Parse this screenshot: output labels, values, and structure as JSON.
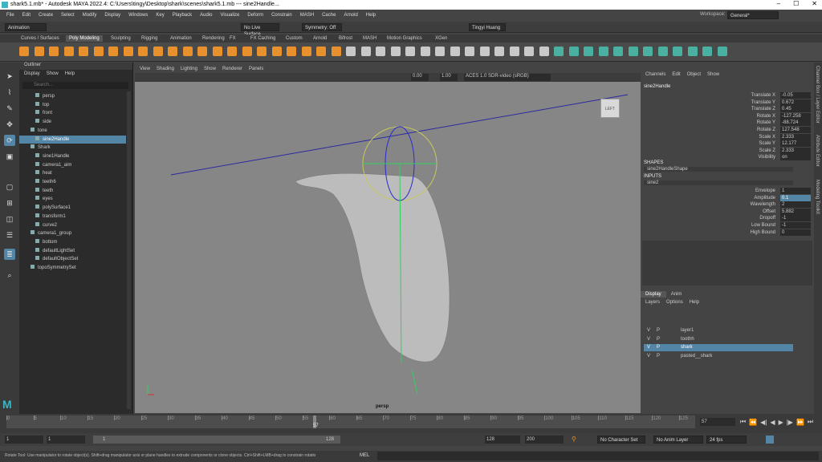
{
  "title": "shark5.1.mb* - Autodesk MAYA 2022.4: C:\\Users\\tingy\\Desktop\\shark\\scenes\\shark5.1.mb --- sine2Handle...",
  "menu": [
    "File",
    "Edit",
    "Create",
    "Select",
    "Modify",
    "Display",
    "Windows",
    "Key",
    "Playback",
    "Audio",
    "Visualize",
    "Deform",
    "Constrain",
    "MASH",
    "Cache",
    "Arnold",
    "Help"
  ],
  "workspace": {
    "label": "Workspace:",
    "value": "General*"
  },
  "statusline": {
    "mode": "Animation",
    "live": "No Live Surface",
    "symmetry": "Symmetry: Off",
    "user": "Tingyi Huang"
  },
  "shelf_tabs": [
    "Curves / Surfaces",
    "Poly Modeling",
    "Sculpting",
    "Rigging",
    "Animation",
    "Rendering",
    "FX",
    "FX Caching",
    "Custom",
    "Arnold",
    "Bifrost",
    "MASH",
    "Motion Graphics",
    "XGen"
  ],
  "outliner": {
    "title": "Outliner",
    "menu": [
      "Display",
      "Show",
      "Help"
    ],
    "search": "Search...",
    "items": [
      "persp",
      "top",
      "front",
      "side",
      "tone",
      "sine2Handle",
      "Shark",
      "sine1Handle",
      "camera1_aim",
      "heat",
      "teeth6",
      "teeth",
      "eyes",
      "polySurface1",
      "transform1",
      "curve2",
      "camera1_group",
      "bottom",
      "defaultLightSet",
      "defaultObjectSet",
      "topoSymmetrySet"
    ]
  },
  "viewport": {
    "menu": [
      "View",
      "Shading",
      "Lighting",
      "Show",
      "Renderer",
      "Panels"
    ],
    "num1": "0.00",
    "num2": "1.00",
    "colorspace": "ACES 1.0 SDR-video (sRGB)",
    "camera": "persp",
    "cube": "LEFT"
  },
  "channelbox": {
    "menu": [
      "Channels",
      "Edit",
      "Object",
      "Show"
    ],
    "object": "sine2Handle",
    "attrs": [
      {
        "n": "Translate X",
        "v": "-0.05"
      },
      {
        "n": "Translate Y",
        "v": "0.672"
      },
      {
        "n": "Translate Z",
        "v": "0.45"
      },
      {
        "n": "Rotate X",
        "v": "-127.258"
      },
      {
        "n": "Rotate Y",
        "v": "-88.724"
      },
      {
        "n": "Rotate Z",
        "v": "127.548"
      },
      {
        "n": "Scale X",
        "v": "2.333"
      },
      {
        "n": "Scale Y",
        "v": "12.177"
      },
      {
        "n": "Scale Z",
        "v": "2.333"
      },
      {
        "n": "Visibility",
        "v": "on"
      }
    ],
    "shapes_label": "SHAPES",
    "shape": "sine2HandleShape",
    "inputs_label": "INPUTS",
    "input": "sine2",
    "inputs": [
      {
        "n": "Envelope",
        "v": "1"
      },
      {
        "n": "Amplitude",
        "v": "0.1"
      },
      {
        "n": "Wavelength",
        "v": "2"
      },
      {
        "n": "Offset",
        "v": "5.882"
      },
      {
        "n": "Dropoff",
        "v": "-1"
      },
      {
        "n": "Low Bound",
        "v": "-1"
      },
      {
        "n": "High Bound",
        "v": "0"
      }
    ]
  },
  "side_tabs": [
    "Channel Box / Layer Editor",
    "Attribute Editor",
    "Modeling Toolkit"
  ],
  "layers": {
    "tabs": [
      "Display",
      "Anim"
    ],
    "menu": [
      "Layers",
      "Options",
      "Help"
    ],
    "rows": [
      {
        "v": "V",
        "p": "P",
        "name": "layer1"
      },
      {
        "v": "V",
        "p": "P",
        "name": "toothh"
      },
      {
        "v": "V",
        "p": "P",
        "name": "shark"
      },
      {
        "v": "V",
        "p": "P",
        "name": "pasted__shark"
      }
    ]
  },
  "timeline": {
    "ticks": [
      "0",
      "5",
      "10",
      "15",
      "20",
      "25",
      "30",
      "35",
      "40",
      "45",
      "50",
      "55",
      "60",
      "65",
      "70",
      "75",
      "80",
      "85",
      "90",
      "95",
      "100",
      "105",
      "110",
      "115",
      "120",
      "125"
    ],
    "current": "57",
    "current_field": "57"
  },
  "range": {
    "start": "1",
    "start2": "1",
    "inner_start": "1",
    "inner_end": "128",
    "end": "128",
    "end2": "200",
    "char": "No Character Set",
    "anim": "No Anim Layer",
    "fps": "24 fps"
  },
  "cmd": {
    "lang": "MEL",
    "help": "Rotate Tool: Use manipulator to rotate object(s). Shift+drag manipulator axis or plane handles to extrude components or clone objects. Ctrl+Shift+LMB+drag to constrain rotatio"
  },
  "colors": {
    "accent": "#5285a6",
    "viewport": "#868686",
    "shelf_orange": "#e8912c"
  }
}
